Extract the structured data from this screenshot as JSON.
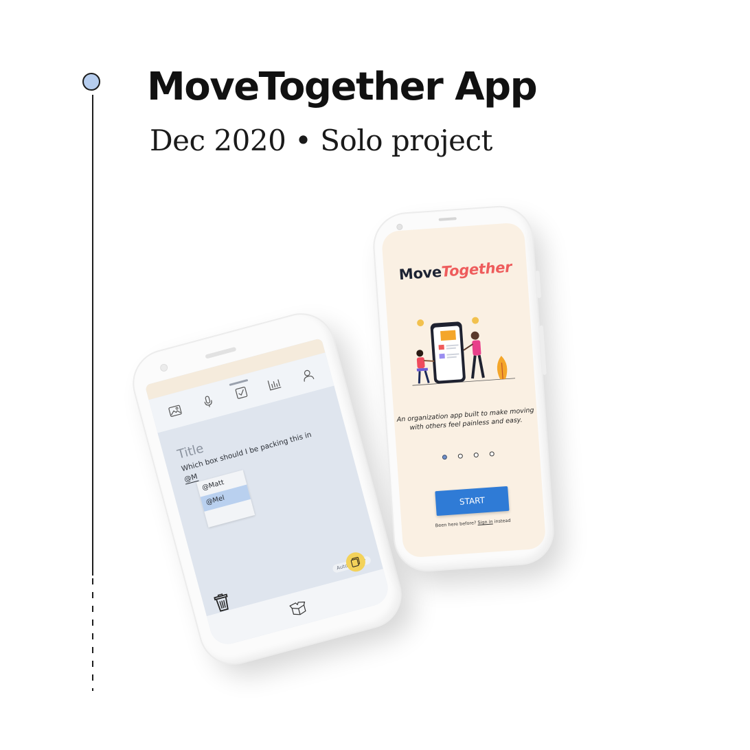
{
  "header": {
    "title": "MoveTogether App",
    "subtitle": "Dec 2020 • Solo project"
  },
  "timeline": {
    "dot_color": "#b6cdee"
  },
  "editor_phone": {
    "toolbar_icons": [
      "image-icon",
      "microphone-icon",
      "checkbox-icon",
      "chart-icon",
      "person-icon"
    ],
    "note_title": "Title",
    "note_text": "Which box should I be packing this in",
    "mention_typed": "@M",
    "mention_options": [
      "@Matt",
      "@Mel"
    ],
    "selected_option": "@Mel",
    "autosaved_label": "Autosaved ✓",
    "bottom_icons": [
      "trash-icon",
      "box-icon",
      "notes-icon"
    ],
    "accent": "#f3d25a",
    "selection_color": "#b9d0ef"
  },
  "onboarding_phone": {
    "logo_move": "Move",
    "logo_together": "Together",
    "tagline_1": "An organization app built to make moving",
    "tagline_2": "with others feel painless and easy.",
    "page_count": 4,
    "active_page": 1,
    "start_label": "START",
    "signin_prefix": "Been here before?",
    "signin_link": "Sign in",
    "signin_suffix": "instead",
    "brand_colors": {
      "dark": "#1d2333",
      "accent": "#ee5c5c",
      "button": "#2f7bd6",
      "background": "#faf0e3"
    }
  }
}
